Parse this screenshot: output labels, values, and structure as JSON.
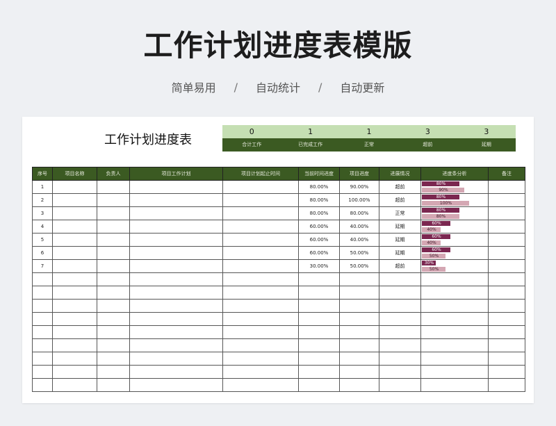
{
  "banner": {
    "title": "工作计划进度表模版",
    "tags": [
      "简单易用",
      "自动统计",
      "自动更新"
    ],
    "separator": "/"
  },
  "sheet": {
    "title": "工作计划进度表",
    "summary": [
      {
        "value": "0",
        "label": "合计工作"
      },
      {
        "value": "1",
        "label": "已完成工作"
      },
      {
        "value": "1",
        "label": "正常"
      },
      {
        "value": "3",
        "label": "超前"
      },
      {
        "value": "3",
        "label": "延期"
      }
    ],
    "columns": [
      "序号",
      "项目名称",
      "负责人",
      "项目工作计划",
      "项目计划起止时间",
      "当前时间进度",
      "项目进度",
      "进展情况",
      "进度条分析",
      "备注"
    ],
    "rows": [
      {
        "no": "1",
        "name": "",
        "owner": "",
        "plan": "",
        "period": "",
        "time_progress": "80.00%",
        "project_progress": "90.00%",
        "status": "超前",
        "bar_current": "80%",
        "bar_progress": "90%",
        "current_fraction": 0.8,
        "progress_fraction": 0.9,
        "note": ""
      },
      {
        "no": "2",
        "name": "",
        "owner": "",
        "plan": "",
        "period": "",
        "time_progress": "80.00%",
        "project_progress": "100.00%",
        "status": "超前",
        "bar_current": "80%",
        "bar_progress": "100%",
        "current_fraction": 0.8,
        "progress_fraction": 1.0,
        "note": ""
      },
      {
        "no": "3",
        "name": "",
        "owner": "",
        "plan": "",
        "period": "",
        "time_progress": "80.00%",
        "project_progress": "80.00%",
        "status": "正常",
        "bar_current": "80%",
        "bar_progress": "80%",
        "current_fraction": 0.8,
        "progress_fraction": 0.8,
        "note": ""
      },
      {
        "no": "4",
        "name": "",
        "owner": "",
        "plan": "",
        "period": "",
        "time_progress": "60.00%",
        "project_progress": "40.00%",
        "status": "延期",
        "bar_current": "60%",
        "bar_progress": "40%",
        "current_fraction": 0.6,
        "progress_fraction": 0.4,
        "note": ""
      },
      {
        "no": "5",
        "name": "",
        "owner": "",
        "plan": "",
        "period": "",
        "time_progress": "60.00%",
        "project_progress": "40.00%",
        "status": "延期",
        "bar_current": "60%",
        "bar_progress": "40%",
        "current_fraction": 0.6,
        "progress_fraction": 0.4,
        "note": ""
      },
      {
        "no": "6",
        "name": "",
        "owner": "",
        "plan": "",
        "period": "",
        "time_progress": "60.00%",
        "project_progress": "50.00%",
        "status": "延期",
        "bar_current": "60%",
        "bar_progress": "50%",
        "current_fraction": 0.6,
        "progress_fraction": 0.5,
        "note": ""
      },
      {
        "no": "7",
        "name": "",
        "owner": "",
        "plan": "",
        "period": "",
        "time_progress": "30.00%",
        "project_progress": "50.00%",
        "status": "超前",
        "bar_current": "30%",
        "bar_progress": "50%",
        "current_fraction": 0.3,
        "progress_fraction": 0.5,
        "note": ""
      }
    ],
    "empty_row_count": 9,
    "colors": {
      "header_green": "#3b5a22",
      "summary_light_green": "#c5dfb3",
      "bar_current": "#7b2750",
      "bar_progress": "#d4a7b3"
    }
  }
}
